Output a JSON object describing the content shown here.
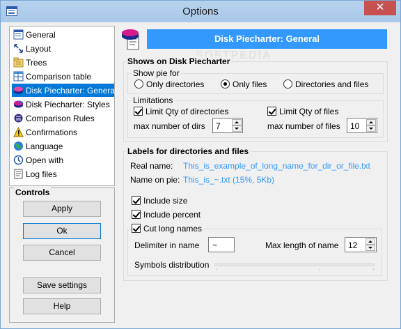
{
  "window": {
    "title": "Options",
    "close_glyph": "✕"
  },
  "watermark": "SOFTPEDIA",
  "tree": {
    "items": [
      {
        "label": "General",
        "icon": "general-icon"
      },
      {
        "label": "Layout",
        "icon": "layout-icon"
      },
      {
        "label": "Trees",
        "icon": "trees-icon"
      },
      {
        "label": "Comparison table",
        "icon": "comparison-table-icon"
      },
      {
        "label": "Disk Piecharter: General",
        "icon": "piechart-icon",
        "selected": true
      },
      {
        "label": "Disk Piecharter: Styles",
        "icon": "piechart-styles-icon"
      },
      {
        "label": "Comparison Rules",
        "icon": "comparison-rules-icon"
      },
      {
        "label": "Confirmations",
        "icon": "warning-icon"
      },
      {
        "label": "Language",
        "icon": "globe-icon"
      },
      {
        "label": "Open with",
        "icon": "open-with-icon"
      },
      {
        "label": "Log files",
        "icon": "log-files-icon"
      }
    ]
  },
  "controls": {
    "title": "Controls",
    "apply": "Apply",
    "ok": "Ok",
    "cancel": "Cancel",
    "save_settings": "Save settings",
    "help": "Help"
  },
  "header": {
    "title": "Disk Piecharter: General"
  },
  "shows": {
    "title": "Shows on Disk Piecharter",
    "show_pie_for": "Show pie for",
    "options": [
      "Only directories",
      "Only files",
      "Directories and files"
    ],
    "selected": "Only files",
    "limitations": "Limitations",
    "limit_dirs_label": "Limit Qty of directories",
    "limit_dirs_checked": true,
    "limit_files_label": "Limit Qty of files",
    "limit_files_checked": true,
    "max_dirs_label": "max number of dirs",
    "max_dirs_value": "7",
    "max_files_label": "max number of files",
    "max_files_value": "10"
  },
  "labels": {
    "title": "Labels for directories and files",
    "real_name_label": "Real name:",
    "real_name_value": "This_is_example_of_long_name_for_dir_or_file.txt",
    "name_on_pie_label": "Name on pie:",
    "name_on_pie_value": "This_is_~.txt (15%, 5Kb)",
    "include_size": "Include size",
    "include_percent": "Include percent",
    "cut_long_names": "Cut long names",
    "delimiter_label": "Delimiter in name",
    "delimiter_value": "~",
    "max_length_label": "Max length of name",
    "max_length_value": "12",
    "symbols_distribution": "Symbols distribution"
  },
  "colors": {
    "accent": "#3399ff",
    "selection": "#0078d7",
    "close": "#c75050"
  }
}
